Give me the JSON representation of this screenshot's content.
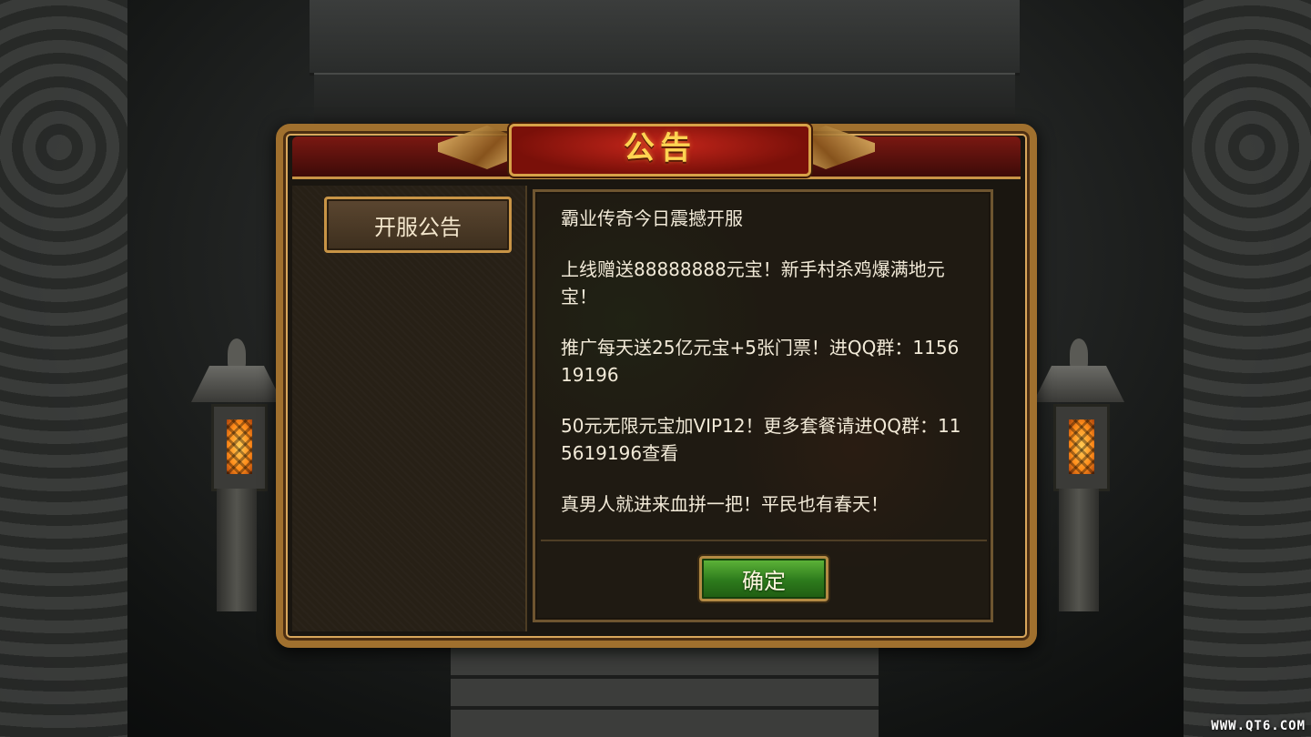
{
  "dialog": {
    "title": "公告",
    "tabs": [
      {
        "label": "开服公告",
        "selected": true
      }
    ],
    "notice_lines": [
      "霸业传奇今日震撼开服",
      "上线赠送88888888元宝！新手村杀鸡爆满地元宝！",
      "推广每天送25亿元宝+5张门票！进QQ群：115619196",
      "50元无限元宝加VIP12！更多套餐请进QQ群：115619196查看",
      "真男人就进来血拼一把！平民也有春天！"
    ],
    "confirm_label": "确定"
  },
  "watermark": "WWW.QT6.COM",
  "colors": {
    "title_gold": "#ffd452",
    "frame_gold": "#c89446",
    "confirm_green": "#2d7a1c",
    "lantern_glow": "#ff8c1a"
  }
}
